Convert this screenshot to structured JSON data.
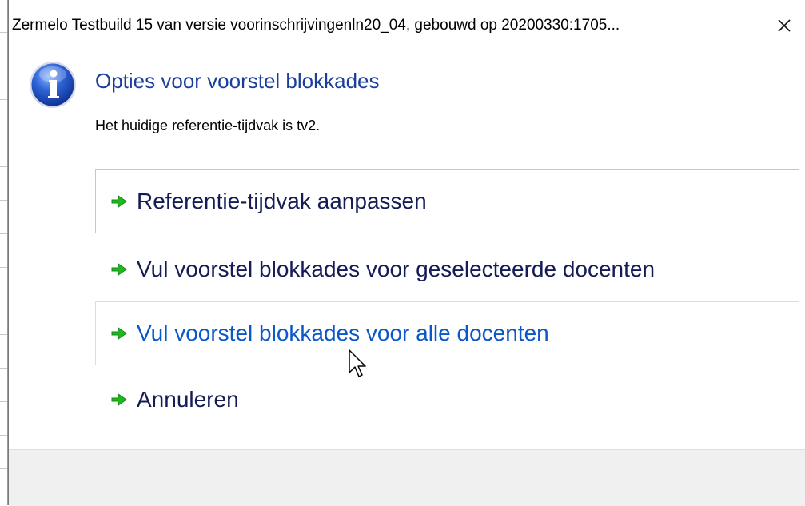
{
  "window": {
    "title": "Zermelo Testbuild 15 van versie voorinschrijvingenln20_04, gebouwd op 20200330:1705...",
    "close_label": "✕"
  },
  "dialog": {
    "icon": "info-icon",
    "main_instruction": "Opties voor voorstel blokkades",
    "content": "Het huidige referentie-tijdvak is tv2."
  },
  "commands": [
    {
      "label": "Referentie-tijdvak aanpassen",
      "icon": "green-arrow-icon",
      "state": "focused"
    },
    {
      "label": "Vul voorstel blokkades voor geselecteerde docenten",
      "icon": "green-arrow-icon",
      "state": "normal"
    },
    {
      "label": "Vul voorstel blokkades voor alle docenten",
      "icon": "green-arrow-icon",
      "state": "hovered"
    },
    {
      "label": "Annuleren",
      "icon": "green-arrow-icon",
      "state": "normal"
    }
  ],
  "colors": {
    "instruction": "#1a3e9c",
    "link_text": "#151c55",
    "link_hover": "#0b57c8",
    "arrow_green": "#1fb81f",
    "focus_border": "#a9cdee",
    "footer_bg": "#f0f0f0"
  }
}
